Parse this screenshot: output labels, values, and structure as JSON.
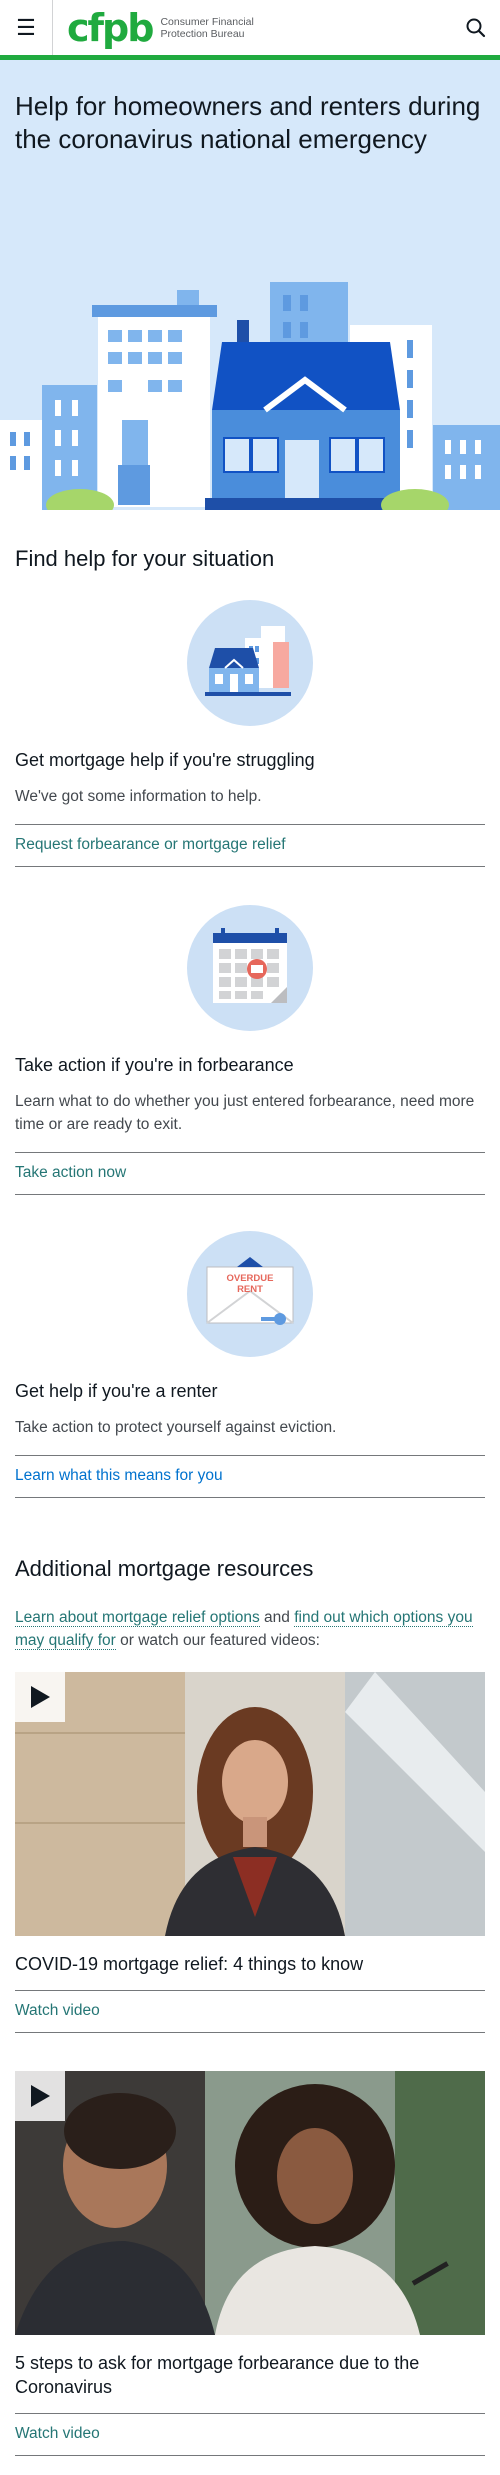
{
  "header": {
    "menu_icon": "hamburger-menu-icon",
    "logo_mark": "cfpb",
    "logo_line1": "Consumer Financial",
    "logo_line2": "Protection Bureau",
    "search_icon": "search-icon",
    "accent_color": "#20aa3f"
  },
  "hero": {
    "title": "Help for homeowners and renters during the coronavirus national emergency",
    "background": "#d6e8fa"
  },
  "situations": {
    "title": "Find help for your situation",
    "cards": [
      {
        "icon": "house-buildings-icon",
        "heading": "Get mortgage help if you're struggling",
        "text": "We've got some information to help.",
        "link": "Request forbearance or mortgage relief"
      },
      {
        "icon": "calendar-icon",
        "heading": "Take action if you're in forbearance",
        "text": "Learn what to do whether you just entered forbearance, need more time or are ready to exit.",
        "link": "Take action now"
      },
      {
        "icon": "overdue-rent-envelope-icon",
        "icon_text_1": "OVERDUE",
        "icon_text_2": "RENT",
        "heading": "Get help if you're a renter",
        "text": "Take action to protect yourself against eviction.",
        "link": "Learn what this means for you"
      }
    ]
  },
  "resources": {
    "title": "Additional mortgage resources",
    "link1": "Learn about mortgage relief options",
    "and": " and ",
    "link2": "find out which options you may qualify for",
    "tail": " or watch our featured videos:",
    "videos": [
      {
        "title": "COVID-19 mortgage relief: 4 things to know",
        "link": "Watch video"
      },
      {
        "title": "5 steps to ask for mortgage forbearance due to the Coronavirus",
        "link": "Watch video"
      }
    ]
  }
}
